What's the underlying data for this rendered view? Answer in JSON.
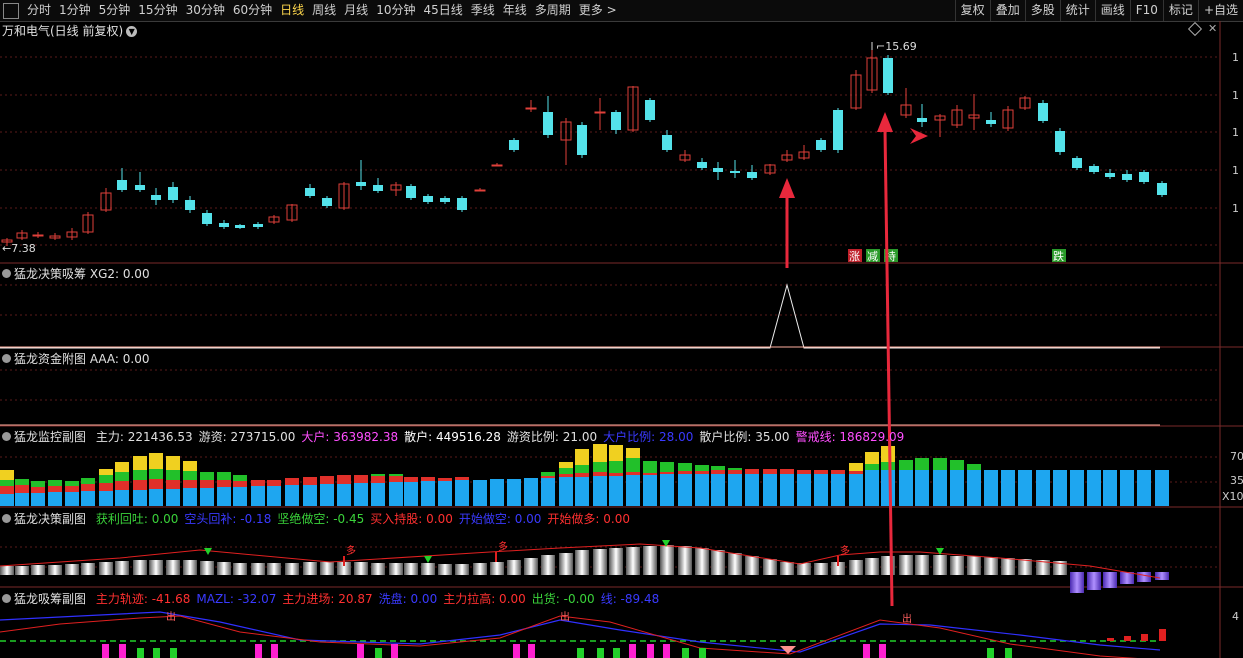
{
  "toolbar": {
    "tabs": [
      "分时",
      "1分钟",
      "5分钟",
      "15分钟",
      "30分钟",
      "60分钟",
      "日线",
      "周线",
      "月线",
      "10分钟",
      "45日线",
      "季线",
      "年线",
      "多周期",
      "更多 >"
    ],
    "active_tab": "日线",
    "right_buttons": [
      "复权",
      "叠加",
      "多股",
      "统计",
      "画线",
      "F10",
      "标记",
      "+自选"
    ]
  },
  "main_pane": {
    "title": "万和电气(日线 前复权)",
    "high_label": "15.69",
    "low_label": "7.38",
    "markers": [
      "涨",
      "减",
      "持",
      "跌"
    ],
    "right_axis_ticks": [
      "1",
      "1",
      "1",
      "1",
      "1"
    ]
  },
  "panes": {
    "xg2": {
      "name": "猛龙决策吸筹",
      "value_text": "XG2: 0.00"
    },
    "aaa": {
      "name": "猛龙资金附图",
      "value_text": "AAA: 0.00"
    },
    "monitor": {
      "name": "猛龙监控副图",
      "items": [
        {
          "text": "主力: 221436.53",
          "color": "#e0e0e0"
        },
        {
          "text": "游资: 273715.00",
          "color": "#e0e0e0"
        },
        {
          "text": "大户: 363982.38",
          "color": "#ff4fff"
        },
        {
          "text": "散户: 449516.28",
          "color": "#ffffff"
        },
        {
          "text": "游资比例: 21.00",
          "color": "#e0e0e0"
        },
        {
          "text": "大户比例: 28.00",
          "color": "#3a3aff"
        },
        {
          "text": "散户比例: 35.00",
          "color": "#e0e0e0"
        },
        {
          "text": "警戒线: 186829.09",
          "color": "#ff4fff"
        }
      ],
      "axis_ticks": [
        "70",
        "35",
        "X10"
      ]
    },
    "decision": {
      "name": "猛龙决策副图",
      "items": [
        {
          "text": "获利回吐: 0.00",
          "color": "#3ad23a"
        },
        {
          "text": "空头回补: -0.18",
          "color": "#3a3aff"
        },
        {
          "text": "坚绝做空: -0.45",
          "color": "#3ad23a"
        },
        {
          "text": "买入持股: 0.00",
          "color": "#ff3030"
        },
        {
          "text": "开始做空: 0.00",
          "color": "#3a3aff"
        },
        {
          "text": "开始做多: 0.00",
          "color": "#ff3030"
        }
      ],
      "marker_text": "多"
    },
    "chip": {
      "name": "猛龙吸筹副图",
      "items": [
        {
          "text": "主力轨迹: -41.68",
          "color": "#ff3030"
        },
        {
          "text": "MAZL: -32.07",
          "color": "#3a3aff"
        },
        {
          "text": "主力进场: 20.87",
          "color": "#ff3030"
        },
        {
          "text": "洗盘: 0.00",
          "color": "#3a3aff"
        },
        {
          "text": "主力拉高: 0.00",
          "color": "#ff3030"
        },
        {
          "text": "出货: -0.00",
          "color": "#3ad23a"
        },
        {
          "text": "线: -89.48",
          "color": "#3a3aff"
        }
      ],
      "marker_text": "出",
      "axis_tick": "4"
    }
  },
  "colors": {
    "up": "#e0403a",
    "down": "#54e2ea",
    "accent_red": "#e8283c",
    "active_tab": "#ffd84d"
  }
}
